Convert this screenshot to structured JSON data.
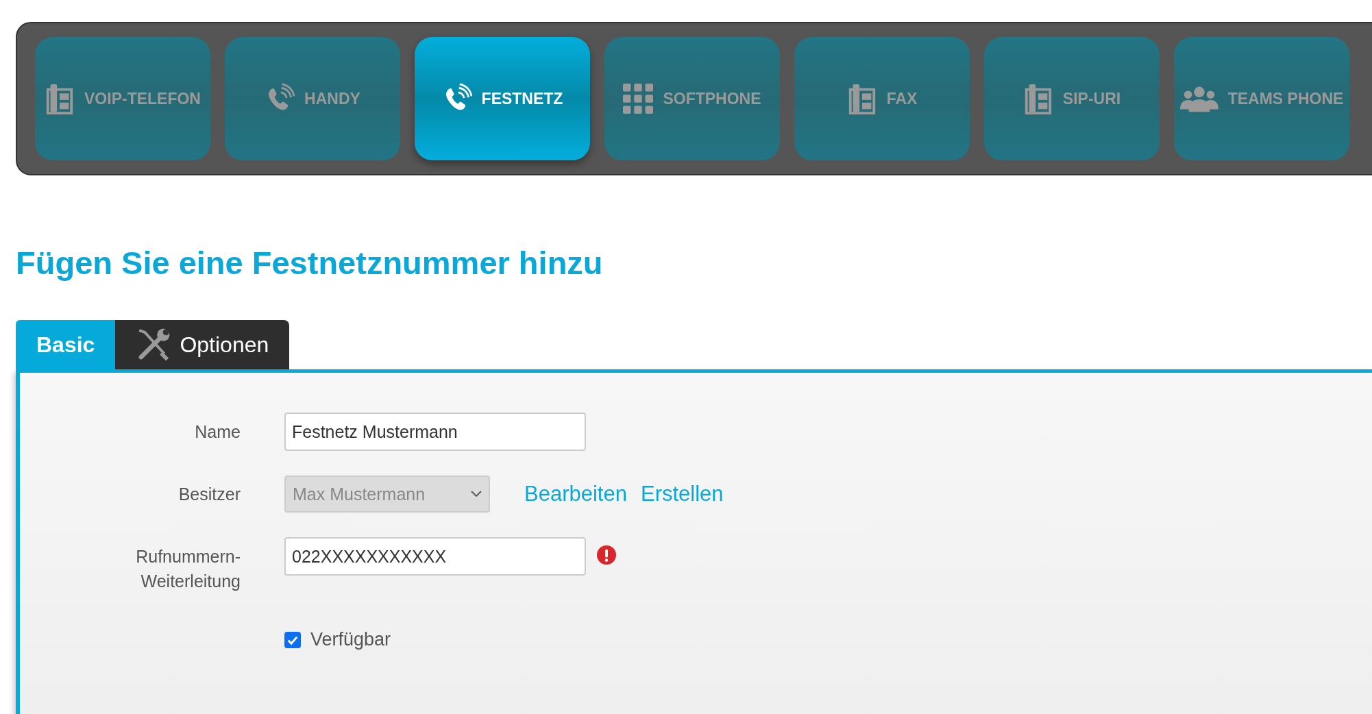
{
  "device_types": [
    {
      "label": "VOIP-TELEFON",
      "kind": "deskphone",
      "selected": false
    },
    {
      "label": "HANDY",
      "kind": "phone",
      "selected": false
    },
    {
      "label": "FESTNETZ",
      "kind": "phone",
      "selected": true
    },
    {
      "label": "SOFTPHONE",
      "kind": "keypad",
      "selected": false
    },
    {
      "label": "FAX",
      "kind": "deskphone",
      "selected": false
    },
    {
      "label": "SIP-URI",
      "kind": "deskphone",
      "selected": false
    },
    {
      "label": "TEAMS PHONE",
      "kind": "group",
      "selected": false
    }
  ],
  "heading": "Fügen Sie eine Festnetznummer hinzu",
  "tabs": [
    {
      "label": "Basic",
      "kind": "plain",
      "selected": true
    },
    {
      "label": "Optionen",
      "kind": "tools",
      "selected": false
    }
  ],
  "form": {
    "name": {
      "label": "Name",
      "value": "Festnetz Mustermann"
    },
    "owner": {
      "label": "Besitzer",
      "value": "Max Mustermann",
      "disabled": true,
      "links": [
        "Bearbeiten",
        "Erstellen"
      ]
    },
    "forwarding": {
      "label_lines": [
        "Rufnummern-",
        "Weiterleitung"
      ],
      "value": "022XXXXXXXXXXX",
      "error": true
    },
    "available": {
      "label": "Verfügbar",
      "checked": true
    }
  }
}
